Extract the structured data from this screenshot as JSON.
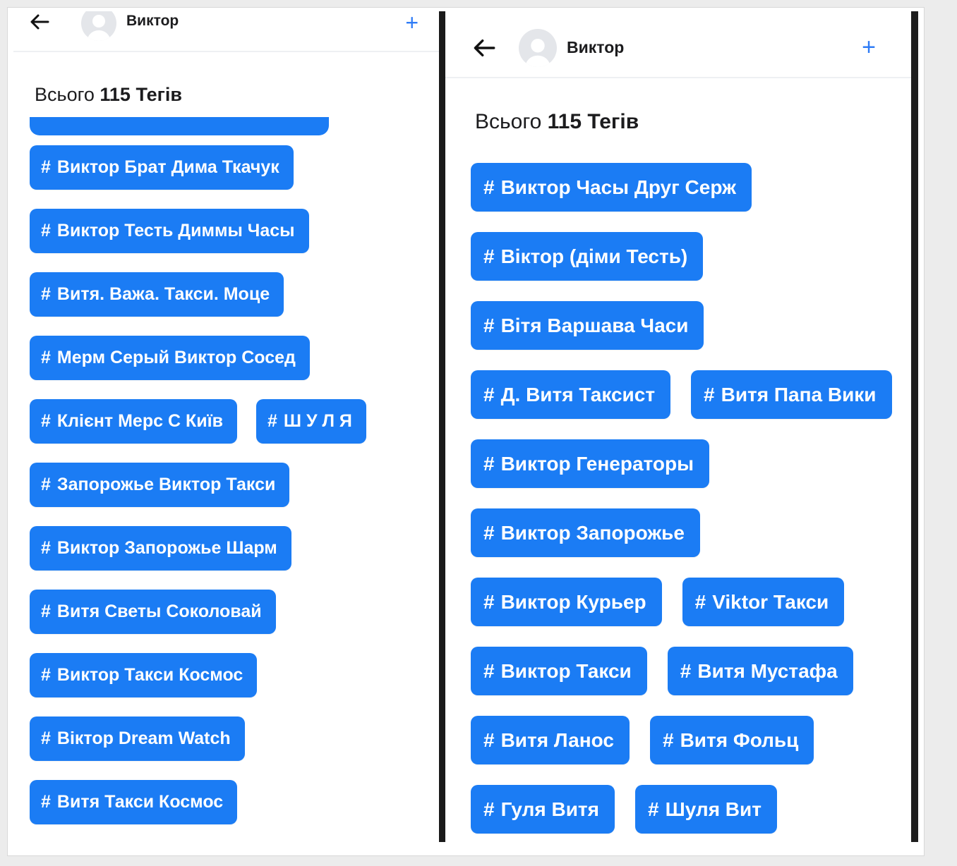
{
  "colors": {
    "chip_bg": "#1b7cf4",
    "chip_text": "#ffffff",
    "accent": "#2f7cf6"
  },
  "icons": {
    "back": "arrow-left-icon",
    "avatar": "person-avatar-icon",
    "add": "plus-icon"
  },
  "left_panel": {
    "header": {
      "name": "Виктор",
      "plus": "+"
    },
    "count": {
      "prefix": "Всього",
      "number": "115",
      "suffix": "Тегів"
    },
    "tag_rows": [
      [
        {
          "hash": "#",
          "label": "Виктор Брат Дима Ткачук"
        }
      ],
      [
        {
          "hash": "#",
          "label": "Виктор Тесть Диммы Часы"
        }
      ],
      [
        {
          "hash": "#",
          "label": "Витя. Важа. Такси. Моце"
        }
      ],
      [
        {
          "hash": "#",
          "label": "Мерм Серый Виктор Сосед"
        }
      ],
      [
        {
          "hash": "#",
          "label": "Клієнт Мерс С Київ"
        },
        {
          "hash": "#",
          "label": "Ш У Л Я"
        }
      ],
      [
        {
          "hash": "#",
          "label": "Запорожье Виктор Такси"
        }
      ],
      [
        {
          "hash": "#",
          "label": "Виктор Запорожье Шарм"
        }
      ],
      [
        {
          "hash": "#",
          "label": "Витя Светы Соколовай"
        }
      ],
      [
        {
          "hash": "#",
          "label": "Виктор Такси Космос"
        }
      ],
      [
        {
          "hash": "#",
          "label": "Віктор Dream Watch"
        }
      ],
      [
        {
          "hash": "#",
          "label": "Витя Такси Космос"
        }
      ]
    ]
  },
  "right_panel": {
    "header": {
      "name": "Виктор",
      "plus": "+"
    },
    "count": {
      "prefix": "Всього",
      "number": "115",
      "suffix": "Тегів"
    },
    "tag_rows": [
      [
        {
          "hash": "#",
          "label": "Виктор Часы Друг Серж"
        }
      ],
      [
        {
          "hash": "#",
          "label": "Віктор (діми Тесть)"
        }
      ],
      [
        {
          "hash": "#",
          "label": "Вітя Варшава Часи"
        }
      ],
      [
        {
          "hash": "#",
          "label": "Д. Витя Таксист"
        },
        {
          "hash": "#",
          "label": "Витя Папа Вики"
        }
      ],
      [
        {
          "hash": "#",
          "label": "Виктор Генераторы"
        }
      ],
      [
        {
          "hash": "#",
          "label": "Виктор Запорожье"
        }
      ],
      [
        {
          "hash": "#",
          "label": "Виктор Курьер"
        },
        {
          "hash": "#",
          "label": "Viktor Такси"
        }
      ],
      [
        {
          "hash": "#",
          "label": "Виктор Такси"
        },
        {
          "hash": "#",
          "label": "Витя Мустафа"
        }
      ],
      [
        {
          "hash": "#",
          "label": "Витя Ланос"
        },
        {
          "hash": "#",
          "label": "Витя Фольц"
        }
      ],
      [
        {
          "hash": "#",
          "label": "Гуля Витя"
        },
        {
          "hash": "#",
          "label": "Шуля Вит"
        }
      ]
    ]
  }
}
